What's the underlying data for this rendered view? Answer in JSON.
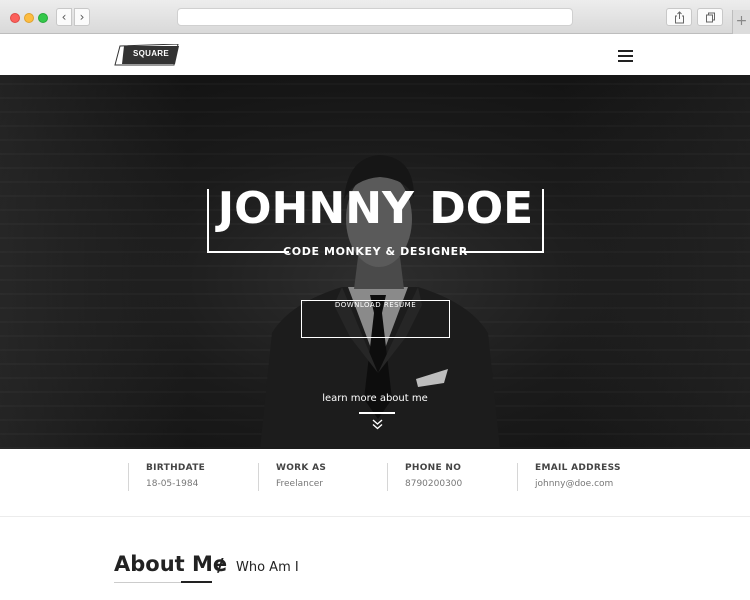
{
  "browser": {
    "nav": {
      "back_icon": "chevron-left-icon",
      "forward_icon": "chevron-right-icon"
    },
    "address_value": "",
    "toolbar": {
      "share_icon": "share-icon",
      "tabs_icon": "tabs-icon",
      "new_tab_icon": "plus-icon"
    }
  },
  "site": {
    "logo_text": "SQUARE",
    "menu_icon": "hamburger-icon"
  },
  "hero": {
    "name": "JOHNNY DOE",
    "tagline": "CODE MONKEY & DESIGNER",
    "resume_button": "DOWNLOAD RESUME",
    "learn_more": "learn more about me",
    "scroll_icon": "double-chevron-down-icon"
  },
  "info": [
    {
      "label": "BIRTHDATE",
      "value": "18-05-1984"
    },
    {
      "label": "WORK AS",
      "value": "Freelancer"
    },
    {
      "label": "PHONE NO",
      "value": "8790200300"
    },
    {
      "label": "EMAIL ADDRESS",
      "value": "johnny@doe.com"
    }
  ],
  "about": {
    "heading": "About Me",
    "separator": "/",
    "subheading": "Who Am I"
  },
  "colors": {
    "hero_bg": "#151515",
    "text_dark": "#222222",
    "text_muted": "#777777",
    "white": "#ffffff"
  }
}
